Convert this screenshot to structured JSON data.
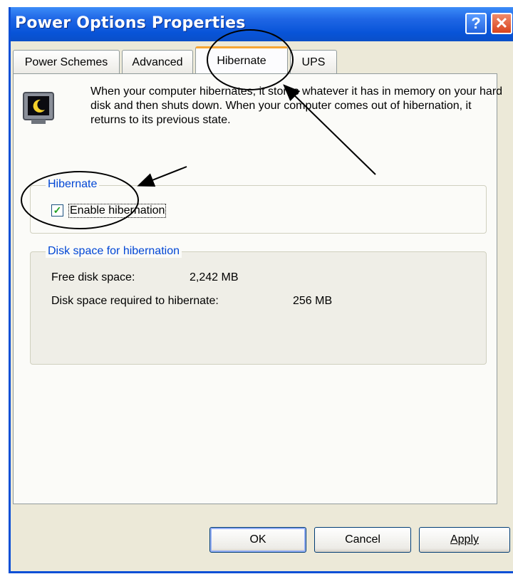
{
  "window": {
    "title": "Power Options Properties",
    "help_glyph": "?",
    "close_glyph": "✕"
  },
  "tabs": [
    {
      "label": "Power Schemes",
      "active": false
    },
    {
      "label": "Advanced",
      "active": false
    },
    {
      "label": "Hibernate",
      "active": true
    },
    {
      "label": "UPS",
      "active": false
    }
  ],
  "hibernate": {
    "description": "When your computer hibernates, it stores whatever it has in memory on your hard disk and then shuts down. When your computer comes out of hibernation, it returns to its previous state.",
    "group_label": "Hibernate",
    "enable_checkbox": {
      "label": "Enable hibernation",
      "checked": true
    }
  },
  "disk_space": {
    "group_label": "Disk space for hibernation",
    "free_label": "Free disk space:",
    "free_value": "2,242 MB",
    "required_label": "Disk space required to hibernate:",
    "required_value": "256 MB"
  },
  "buttons": {
    "ok": "OK",
    "cancel": "Cancel",
    "apply": "Apply"
  },
  "colors": {
    "titlebar": "#0854D8",
    "group_label": "#0046D5",
    "active_tab_accent": "#F6A634",
    "check": "#21A121"
  },
  "icons": {
    "hibernate": "monitor-moon-icon",
    "help": "help-icon",
    "close": "close-icon"
  }
}
